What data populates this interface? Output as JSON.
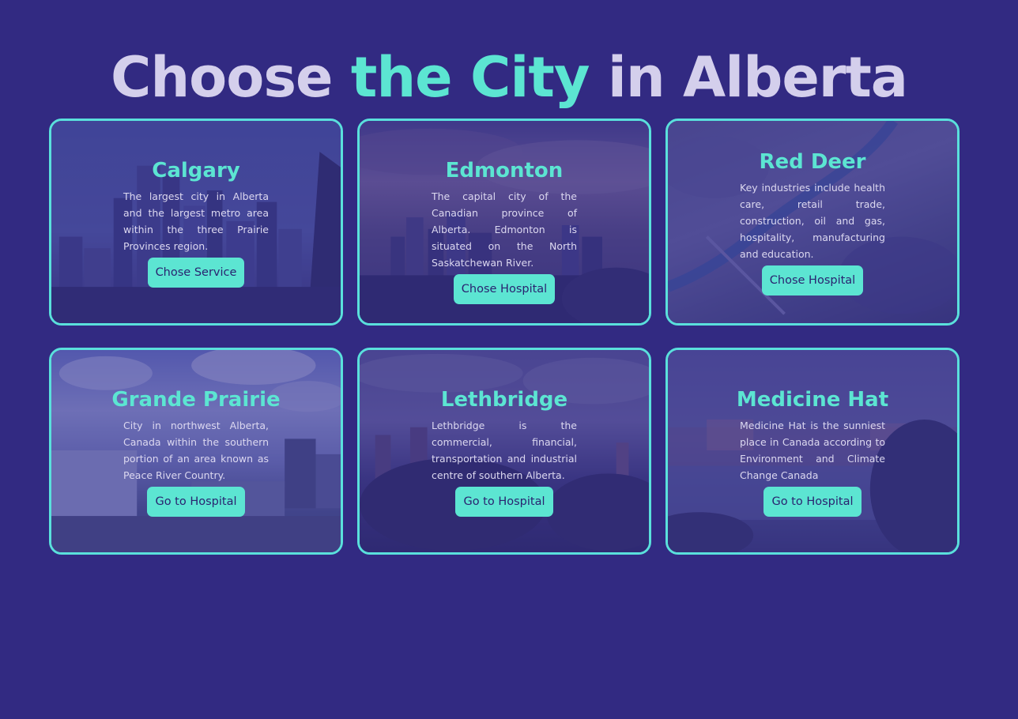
{
  "header": {
    "title_part1": "Choose ",
    "title_accent": "the City",
    "title_part2": " in Alberta"
  },
  "colors": {
    "background": "#322a82",
    "accent": "#5ce5d2",
    "title_text": "#d4cfec",
    "card_border": "#5ae0dc"
  },
  "cards": [
    {
      "name": "Calgary",
      "description": "The largest city in Alberta and the largest metro area within the three Prairie Provinces region.",
      "button": "Chose Service"
    },
    {
      "name": "Edmonton",
      "description": "The capital city of the Canadian province of Alberta. Edmonton is situated on the North Saskatchewan River.",
      "button": "Chose Hospital"
    },
    {
      "name": "Red Deer",
      "description": "Key industries include health care, retail trade, construction, oil and gas, hospitality, manufacturing and education.",
      "button": "Chose Hospital"
    },
    {
      "name": "Grande Prairie",
      "description": "City in northwest Alberta, Canada within the southern portion of an area known as Peace River Country.",
      "button": "Go to Hospital"
    },
    {
      "name": "Lethbridge",
      "description": "Lethbridge is the commercial, financial, transportation and industrial centre of southern Alberta.",
      "button": "Go to Hospital"
    },
    {
      "name": "Medicine Hat",
      "description": "Medicine Hat is the sunniest place in Canada according to Environment and Climate Change Canada",
      "button": "Go to Hospital"
    }
  ]
}
